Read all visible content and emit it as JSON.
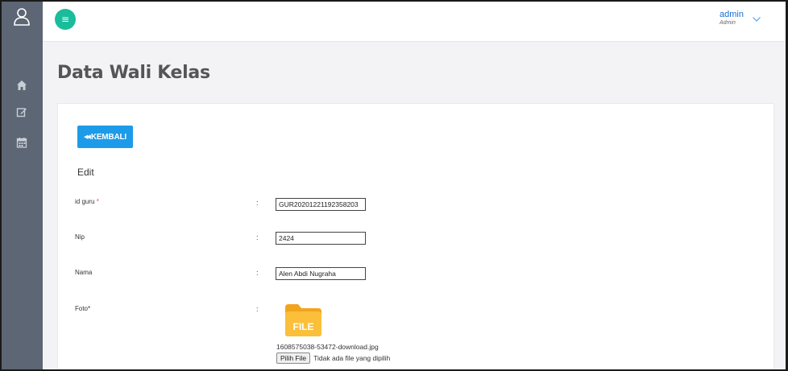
{
  "header": {
    "menu_icon": "hamburger-icon",
    "user_name": "admin",
    "user_role": "Admin"
  },
  "sidebar": {
    "items": [
      {
        "icon": "user-icon"
      },
      {
        "icon": "home-icon"
      },
      {
        "icon": "edit-icon"
      },
      {
        "icon": "calendar-icon"
      }
    ]
  },
  "page": {
    "title": "Data Wali Kelas"
  },
  "form": {
    "back_label": "KEMBALI",
    "section_title": "Edit",
    "fields": [
      {
        "label": "id guru",
        "required": "*",
        "colon": ":",
        "value": "GUR20201221192358203"
      },
      {
        "label": "Nip",
        "colon": ":",
        "value": "2424"
      },
      {
        "label": "Nama",
        "colon": ":",
        "value": "Alen Abdi Nugraha"
      },
      {
        "label": "Foto*",
        "colon": ":"
      }
    ],
    "photo": {
      "icon_label": "FILE",
      "file_name": "1608575038-53472-download.jpg",
      "choose_button": "Pilih File",
      "no_file_text": "Tidak ada file yang dipilih"
    }
  },
  "colors": {
    "sidebar_bg": "#5d6674",
    "menu_button": "#1abc9c",
    "back_button": "#1e9be8",
    "required_mark": "#e74c3c",
    "folder": "#f7a823"
  }
}
